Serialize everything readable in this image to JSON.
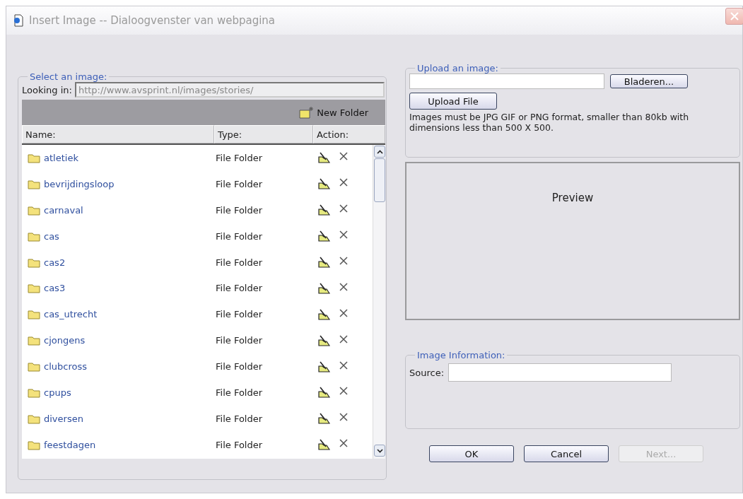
{
  "window": {
    "title": "Insert Image -- Dialoogvenster van webpagina"
  },
  "browser": {
    "legend": "Select an image:",
    "looking_in_label": "Looking in:",
    "looking_in_value": "http://www.avsprint.nl/images/stories/",
    "new_folder": "New Folder",
    "columns": [
      "Name:",
      "Type:",
      "Action:"
    ],
    "rows": [
      {
        "name": "atletiek",
        "type": "File Folder"
      },
      {
        "name": "bevrijdingsloop",
        "type": "File Folder"
      },
      {
        "name": "carnaval",
        "type": "File Folder"
      },
      {
        "name": "cas",
        "type": "File Folder"
      },
      {
        "name": "cas2",
        "type": "File Folder"
      },
      {
        "name": "cas3",
        "type": "File Folder"
      },
      {
        "name": "cas_utrecht",
        "type": "File Folder"
      },
      {
        "name": "cjongens",
        "type": "File Folder"
      },
      {
        "name": "clubcross",
        "type": "File Folder"
      },
      {
        "name": "cpups",
        "type": "File Folder"
      },
      {
        "name": "diversen",
        "type": "File Folder"
      },
      {
        "name": "feestdagen",
        "type": "File Folder"
      }
    ]
  },
  "upload": {
    "legend": "Upload an image:",
    "browse_button": "Bladeren...",
    "upload_button": "Upload File",
    "note": "Images must be JPG GIF or PNG format, smaller than 80kb with dimensions less than 500 X 500."
  },
  "preview": {
    "label": "Preview"
  },
  "image_information": {
    "legend": "Image Information:",
    "source_label": "Source:"
  },
  "buttons": [
    {
      "label": "OK",
      "disabled": false
    },
    {
      "label": "Cancel",
      "disabled": false
    },
    {
      "label": "Next...",
      "disabled": true
    }
  ]
}
